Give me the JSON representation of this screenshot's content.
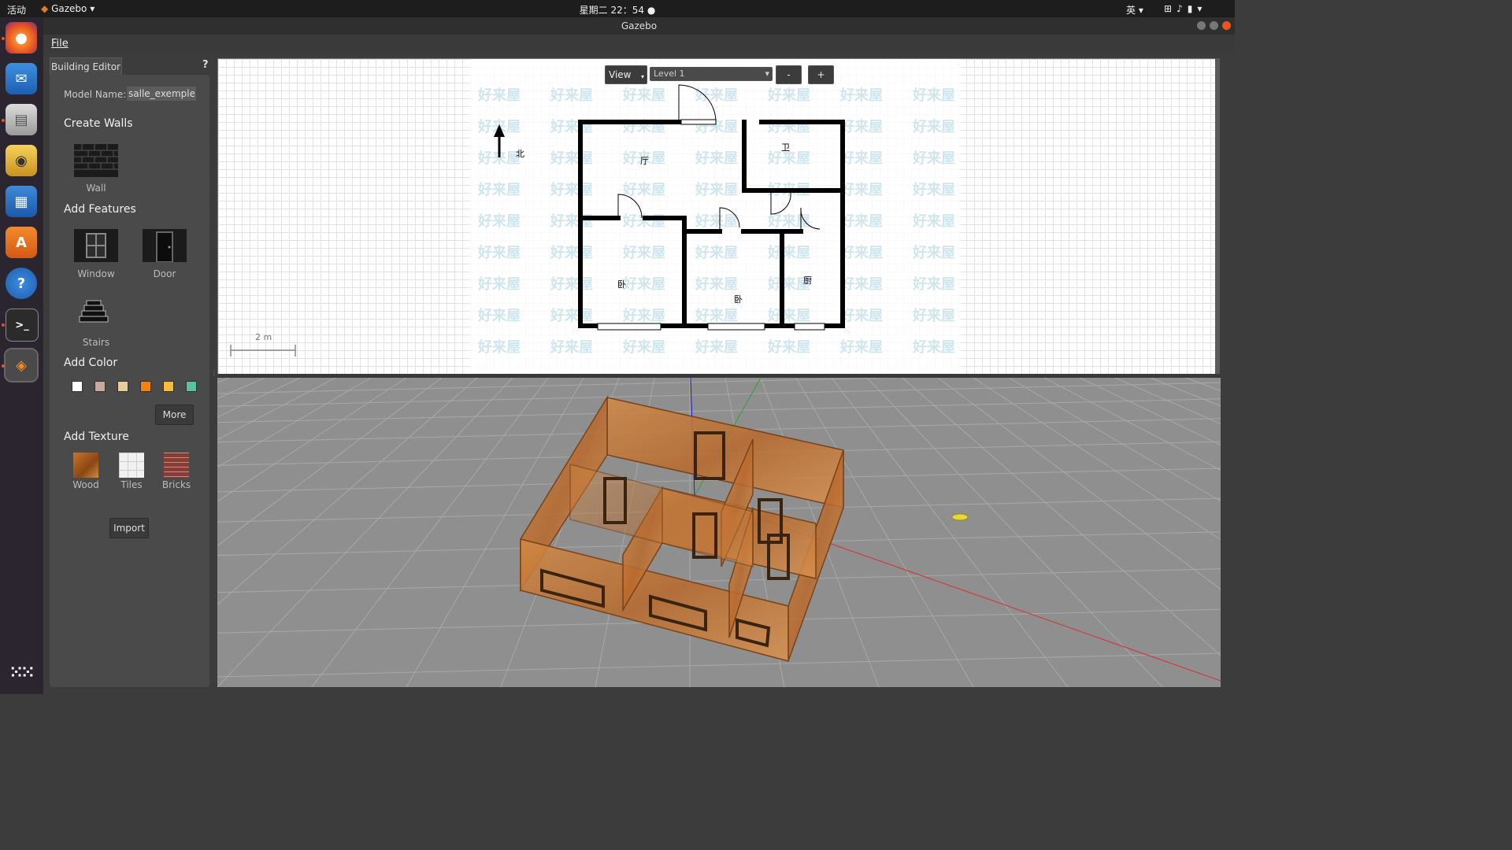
{
  "topbar": {
    "activities": "活动",
    "app_menu": "Gazebo",
    "clock": "星期二 22：54",
    "input_method": "英",
    "tray_icons": [
      "network-icon",
      "volume-icon",
      "battery-icon",
      "power-menu-icon"
    ]
  },
  "window": {
    "title": "Gazebo",
    "close_color": "#e95420"
  },
  "dock": {
    "apps": [
      "firefox-icon",
      "thunderbird-icon",
      "files-icon",
      "rhythmbox-icon",
      "writer-icon",
      "software-center-icon",
      "help-icon",
      "terminal-icon",
      "gazebo-icon"
    ],
    "show_apps": "show-applications-icon"
  },
  "menu": {
    "file": "File"
  },
  "panel": {
    "tab": "Building Editor",
    "help": "?",
    "model_name_label": "Model Name:",
    "model_name_value": "salle_exemple",
    "create_walls": "Create Walls",
    "wall": "Wall",
    "add_features": "Add Features",
    "window": "Window",
    "door": "Door",
    "stairs": "Stairs",
    "add_color": "Add Color",
    "colors": [
      "#ffffff",
      "#c9a89f",
      "#e9cc98",
      "#f5820d",
      "#f7bb3a",
      "#57c3a0"
    ],
    "more": "More",
    "add_texture": "Add Texture",
    "textures": [
      "Wood",
      "Tiles",
      "Bricks"
    ],
    "import": "Import"
  },
  "editor2d": {
    "view_button": "View",
    "level_select": "Level 1",
    "zoom_out": "-",
    "zoom_in": "+",
    "scale_label": "2 m",
    "north_label": "北",
    "room_labels": [
      "厅",
      "卫",
      "卧",
      "卧",
      "厨"
    ],
    "watermark": "好来屋"
  }
}
